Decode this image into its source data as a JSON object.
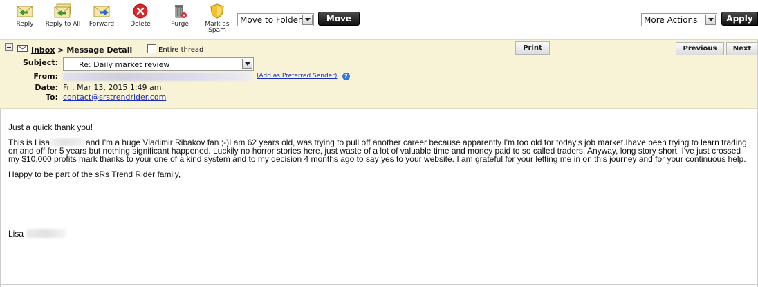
{
  "toolbar": {
    "buttons": [
      {
        "label": "Reply",
        "icon": "reply-icon"
      },
      {
        "label": "Reply to All",
        "icon": "reply-all-icon"
      },
      {
        "label": "Forward",
        "icon": "forward-icon"
      },
      {
        "label": "Delete",
        "icon": "delete-icon"
      },
      {
        "label": "Purge",
        "icon": "purge-icon"
      },
      {
        "label": "Mark as Spam",
        "icon": "spam-shield-icon"
      }
    ],
    "move_folder_select": "Move to Folder",
    "move_button": "Move",
    "more_actions_select": "More Actions",
    "apply_button": "Apply"
  },
  "header": {
    "breadcrumb_inbox": "Inbox",
    "breadcrumb_rest": " > Message Detail",
    "entire_thread_label": "Entire thread",
    "print_button": "Print",
    "previous_button": "Previous",
    "next_button": "Next",
    "subject_label": "Subject:",
    "subject_value": "Re: Daily market review",
    "from_label": "From:",
    "add_preferred": "(Add as Preferred Sender)",
    "date_label": "Date:",
    "date_value": "Fri, Mar 13, 2015 1:49 am",
    "to_label": "To:",
    "to_value": "contact@srstrendrider.com"
  },
  "message": {
    "greeting": "Just a quick thank you!",
    "body_start": "This is Lisa",
    "body_rest": "and I'm a huge Vladimir Ribakov fan ;-)I am 62 years old, was trying to pull off another career because apparently I'm too old for today's job market.Ihave been trying to learn trading on and off for 5 years but nothing significant happened. Luckily no horror stories here, just waste of a lot of valuable time and money paid to so called traders. Anyway, long story short, I've just crossed my $10,000 profits mark thanks to your one of a kind system and to my decision 4 months ago to say yes to your website. I am grateful for your letting me in on this journey and for your continuous help.",
    "closing": "Happy to be part of the sRs Trend Rider family,",
    "signature": "Lisa"
  },
  "colors": {
    "header_bg": "#f8f2d7",
    "link": "#1a2fbf",
    "dark_button": "#111111"
  }
}
